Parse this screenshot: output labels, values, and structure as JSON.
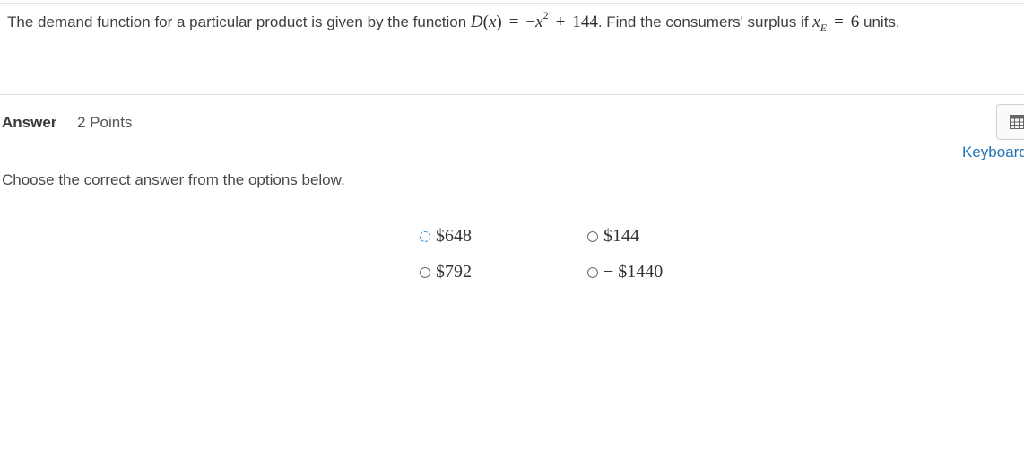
{
  "question": {
    "text_before": "The demand function for a particular product is given by the function ",
    "func_name": "D",
    "func_var": "x",
    "equals": "=",
    "minus": "−",
    "base": "x",
    "exponent": "2",
    "plus": "+",
    "constant": "144",
    "text_middle": ". Find the consumers' surplus if ",
    "xe_base": "x",
    "xe_sub": "E",
    "xe_value": "6",
    "text_after": " units."
  },
  "answer": {
    "label": "Answer",
    "points": "2 Points"
  },
  "tools": {
    "calculator_icon": "calculator-icon",
    "keyboard_label": "Keyboard"
  },
  "instructions": "Choose the correct answer from the options below.",
  "options": [
    {
      "label": "$648",
      "selected": false
    },
    {
      "label": "$144",
      "selected": false
    },
    {
      "label": "$792",
      "selected": false
    },
    {
      "label": "− $1440",
      "selected": false
    }
  ],
  "colors": {
    "link": "#1f73b7",
    "focus_ring": "#2d8fd5"
  }
}
